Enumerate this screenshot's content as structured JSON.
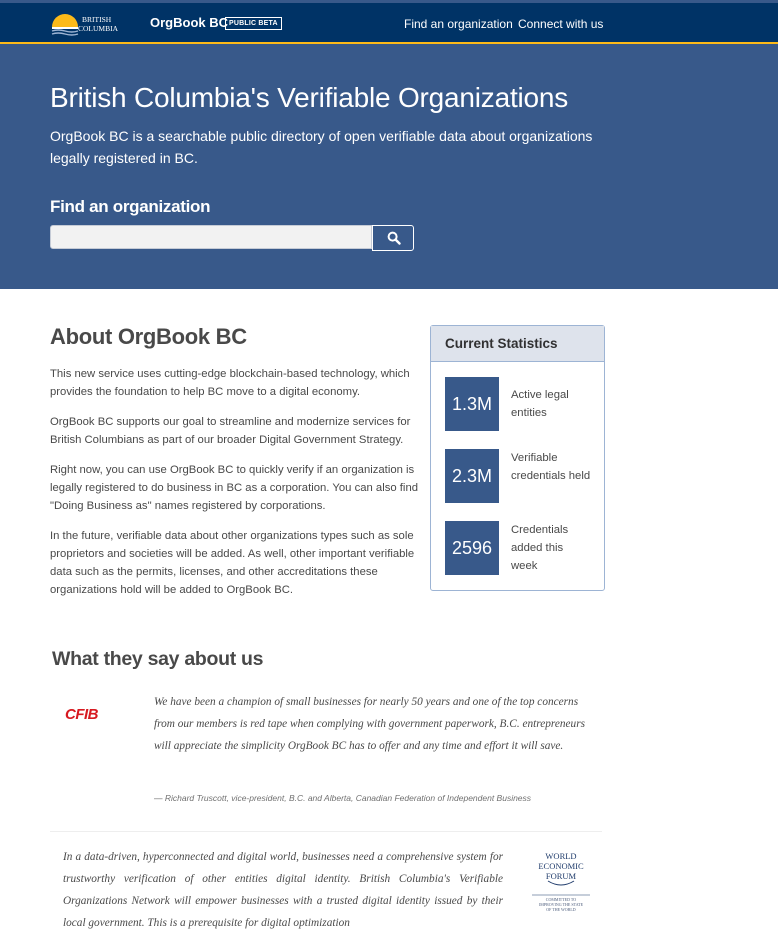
{
  "header": {
    "logo_alt": "British Columbia",
    "app_title": "OrgBook BC",
    "beta_badge": "PUBLIC BETA",
    "nav": [
      {
        "label": "Find an organization"
      },
      {
        "label": "Connect with us"
      }
    ]
  },
  "hero": {
    "title": "British Columbia's Verifiable Organizations",
    "subtitle": "OrgBook BC is a searchable public directory of open verifiable data about organizations legally registered in BC.",
    "search_label": "Find an organization",
    "search_value": "",
    "search_icon": "search-icon"
  },
  "about": {
    "title": "About OrgBook BC",
    "paragraphs": [
      "This new service uses cutting-edge blockchain-based technology, which provides the foundation to help BC move to a digital economy.",
      "OrgBook BC supports our goal to streamline and modernize services for British Columbians as part of our broader Digital Government Strategy.",
      "Right now, you can use OrgBook BC to quickly verify if an organization is legally registered to do business in BC as a corporation. You can also find \"Doing Business as\" names registered by corporations.",
      "In the future, verifiable data about other organizations types such as sole proprietors and societies will be added. As well, other important verifiable data such as the permits, licenses, and other accreditations these organizations hold will be added to OrgBook BC."
    ]
  },
  "stats": {
    "title": "Current Statistics",
    "items": [
      {
        "value": "1.3M",
        "label": "Active legal entities"
      },
      {
        "value": "2.3M",
        "label": "Verifiable credentials held"
      },
      {
        "value": "2596",
        "label": "Credentials added this week"
      }
    ]
  },
  "testimonials": {
    "title": "What they say about us",
    "items": [
      {
        "logo_text": "CFIB",
        "quote": "We have been a champion of small businesses for nearly 50 years and one of the top concerns from our members is red tape when complying with government paperwork, B.C. entrepreneurs will appreciate the simplicity OrgBook BC has to offer and any time and effort it will save.",
        "attribution": "— Richard Truscott, vice-president, B.C. and Alberta, Canadian Federation of Independent Business"
      },
      {
        "quote": "In a data-driven, hyperconnected and digital world, businesses need a comprehensive system for trustworthy verification of other entities digital identity. British Columbia's Verifiable Organizations Network will empower businesses with a trusted digital identity issued by their local government. This is a prerequisite for digital optimization",
        "logo_lines": [
          "WORLD",
          "ECONOMIC",
          "FORUM"
        ],
        "logo_tagline": [
          "COMMITTED TO",
          "IMPROVING THE STATE",
          "OF THE WORLD"
        ]
      }
    ]
  },
  "colors": {
    "header_bg": "#003366",
    "accent_gold": "#fcba19",
    "hero_bg": "#38598a",
    "stat_box": "#38598a",
    "cfib_red": "#d71920"
  }
}
